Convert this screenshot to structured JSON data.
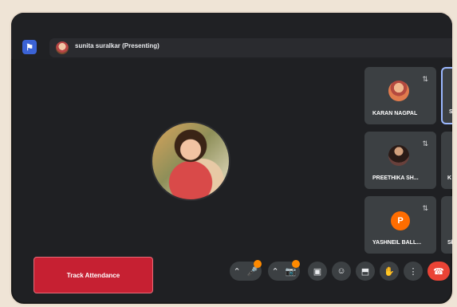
{
  "topbar": {
    "presenter_label": "sunita suralkar (Presenting)"
  },
  "participants": [
    {
      "name": "KARAN NAGPAL"
    },
    {
      "name": "PREETHIKA SH..."
    },
    {
      "name": "YASHNEIL BALL..."
    }
  ],
  "partial_tiles": [
    {
      "label": "Sı"
    },
    {
      "label": "K"
    },
    {
      "label": "Sł"
    }
  ],
  "yashneil_initial": "P",
  "track_button": {
    "label": "Track Attendance"
  },
  "colors": {
    "background": "#1f2023",
    "tile": "#3c4043",
    "track_button": "#c62032",
    "end_call": "#ea4335"
  }
}
